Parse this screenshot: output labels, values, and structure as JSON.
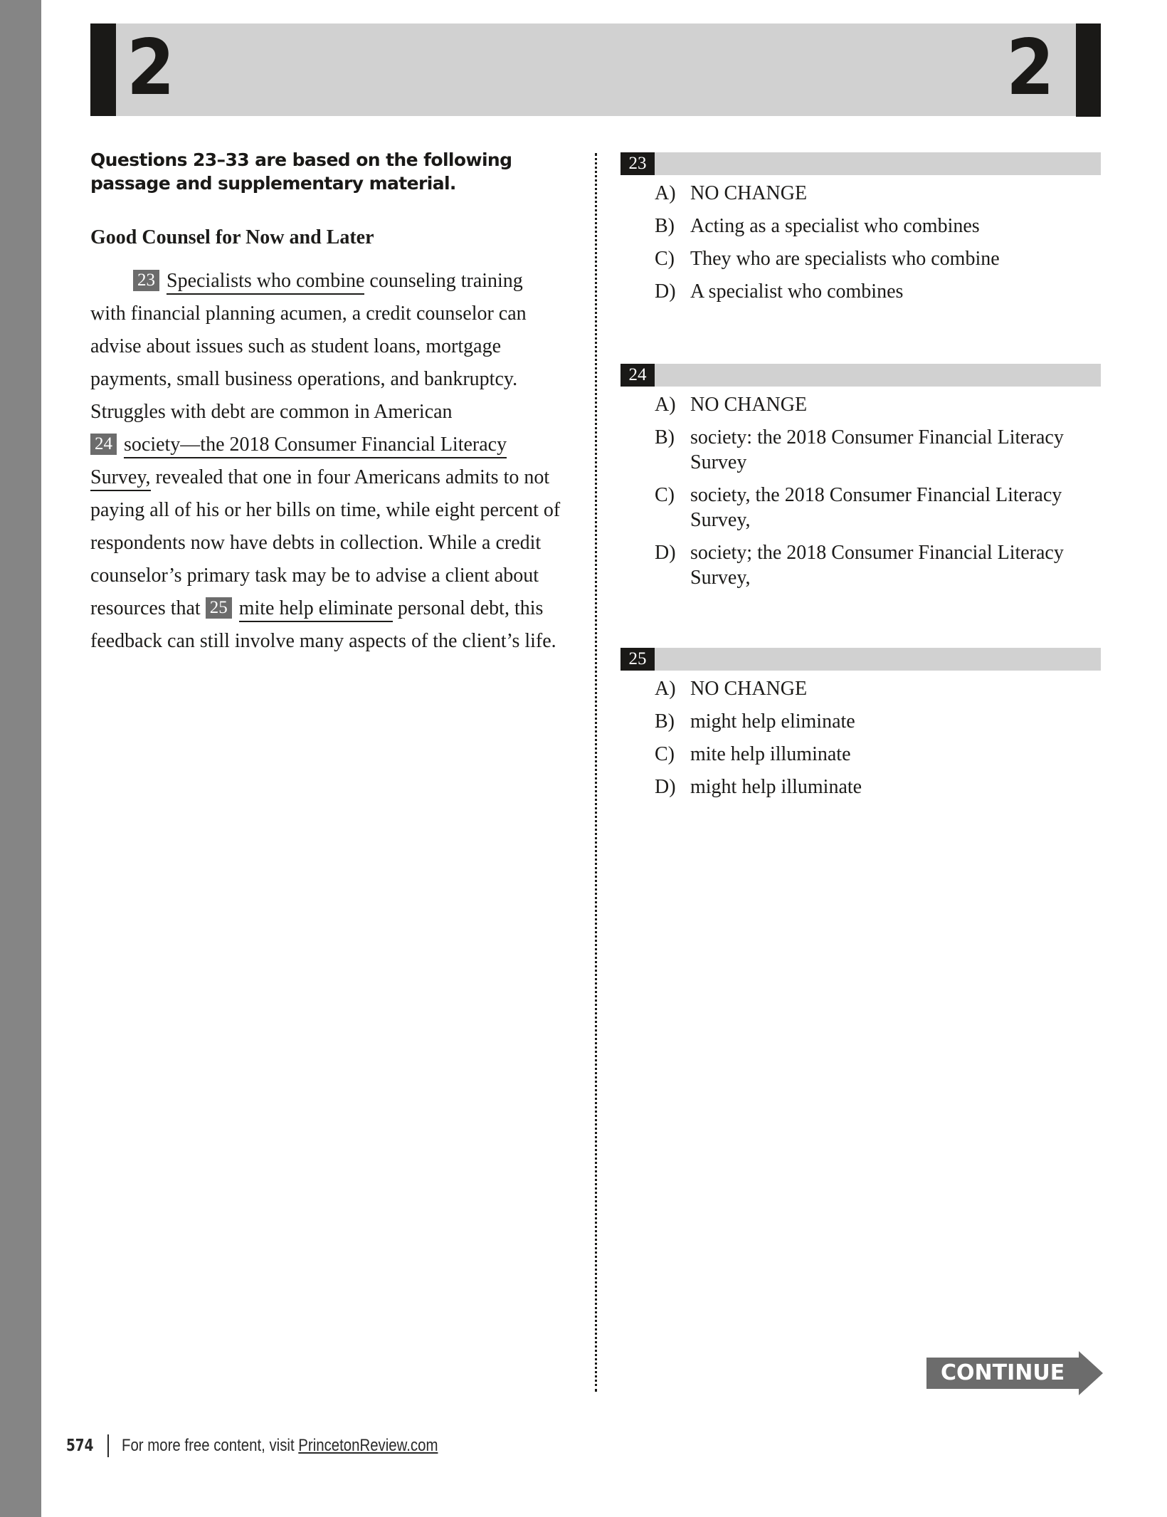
{
  "header": {
    "section_number_left": "2",
    "section_number_right": "2"
  },
  "intro": "Questions 23–33 are based on the following passage and supplementary material.",
  "passage": {
    "title": "Good Counsel for Now and Later",
    "lines": [
      {
        "q": "23",
        "underlined": "Specialists who combine",
        "after": " counseling training"
      },
      {
        "text": "with financial planning acumen, a credit counselor can"
      },
      {
        "text": "advise about issues such as student loans, mortgage"
      },
      {
        "text": "payments, small business operations, and bankruptcy."
      },
      {
        "text": "Struggles with debt are common in American"
      },
      {
        "q": "24",
        "underlined": "society—the 2018 Consumer Financial Literacy",
        "after": ""
      },
      {
        "underlined": "Survey,",
        "after": " revealed that one in four Americans admits to not"
      },
      {
        "text": "paying all of his or her bills on time, while eight percent of"
      },
      {
        "text": "respondents now have debts in collection. While a credit"
      },
      {
        "text": "counselor’s primary task may be to advise a client about"
      },
      {
        "before": "resources that ",
        "q": "25",
        "underlined": "mite help eliminate",
        "after": " personal debt, this"
      },
      {
        "text": "feedback can still involve many aspects of the client’s life."
      }
    ]
  },
  "questions": [
    {
      "number": "23",
      "choices": [
        {
          "letter": "A)",
          "text": "NO CHANGE"
        },
        {
          "letter": "B)",
          "text": "Acting as a specialist who combines"
        },
        {
          "letter": "C)",
          "text": "They who are specialists who combine"
        },
        {
          "letter": "D)",
          "text": "A specialist who combines"
        }
      ]
    },
    {
      "number": "24",
      "choices": [
        {
          "letter": "A)",
          "text": "NO CHANGE"
        },
        {
          "letter": "B)",
          "text": "society: the 2018 Consumer Financial Literacy Survey"
        },
        {
          "letter": "C)",
          "text": "society, the 2018 Consumer Financial Literacy Survey,"
        },
        {
          "letter": "D)",
          "text": "society; the 2018 Consumer Financial Literacy Survey,"
        }
      ]
    },
    {
      "number": "25",
      "choices": [
        {
          "letter": "A)",
          "text": "NO CHANGE"
        },
        {
          "letter": "B)",
          "text": "might help eliminate"
        },
        {
          "letter": "C)",
          "text": "mite help illuminate"
        },
        {
          "letter": "D)",
          "text": "might help illuminate"
        }
      ]
    }
  ],
  "continue_label": "CONTINUE",
  "colors": {
    "header_band": "#d1d1d1",
    "dark": "#1a1917",
    "question_marker": "#6c6c6c",
    "continue_arrow": "#6c6c6c",
    "side_strip": "#858585"
  },
  "footer": {
    "page_number": "574",
    "text": "For more free content, visit ",
    "link": "PrincetonReview.com"
  }
}
